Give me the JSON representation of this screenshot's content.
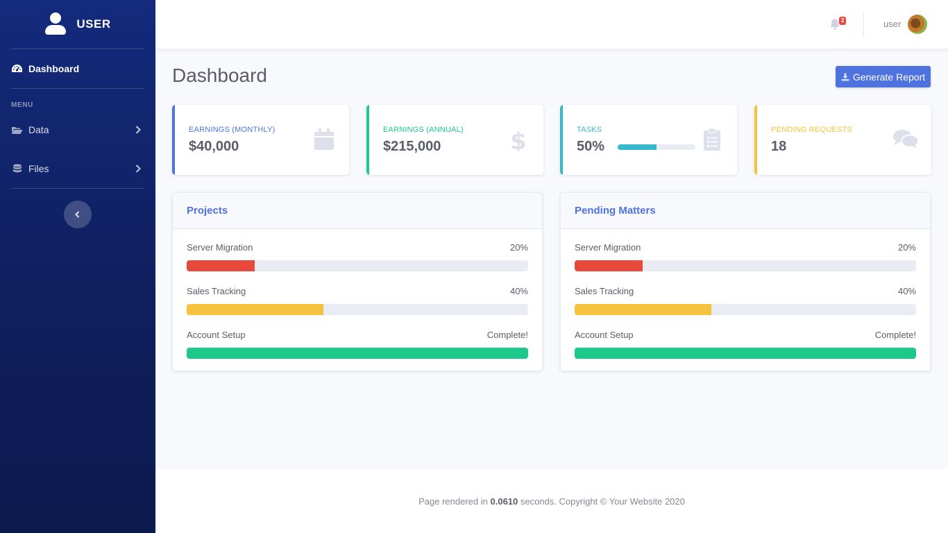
{
  "sidebar": {
    "brand": "USER",
    "active_item": {
      "label": "Dashboard",
      "icon": "tachometer-icon"
    },
    "menu_heading": "MENU",
    "items": [
      {
        "label": "Data",
        "icon": "folder-open-icon"
      },
      {
        "label": "Files",
        "icon": "database-icon"
      }
    ],
    "toggle_icon": "chevron-left-icon"
  },
  "topbar": {
    "notification_count": "2",
    "user_name": "user"
  },
  "page": {
    "title": "Dashboard",
    "report_button": "Generate Report"
  },
  "cards": [
    {
      "label": "EARNINGS (MONTHLY)",
      "value": "$40,000",
      "color": "#4e73df",
      "icon": "calendar-icon"
    },
    {
      "label": "EARNINGS (ANNUAL)",
      "value": "$215,000",
      "color": "#1cc88a",
      "icon": "dollar-icon"
    },
    {
      "label": "TASKS",
      "value": "50%",
      "progress": 0.5,
      "color": "#36b9cc",
      "icon": "clipboard-list-icon"
    },
    {
      "label": "PENDING REQUESTS",
      "value": "18",
      "color": "#f6c23e",
      "icon": "comments-icon"
    }
  ],
  "panels": [
    {
      "title": "Projects",
      "rows": [
        {
          "label": "Server Migration",
          "value": "20%",
          "fraction": 0.2,
          "color": "#e74a3b"
        },
        {
          "label": "Sales Tracking",
          "value": "40%",
          "fraction": 0.4,
          "color": "#f6c23e"
        },
        {
          "label": "Account Setup",
          "value": "Complete!",
          "fraction": 1.0,
          "color": "#1cc88a"
        }
      ]
    },
    {
      "title": "Pending Matters",
      "rows": [
        {
          "label": "Server Migration",
          "value": "20%",
          "fraction": 0.2,
          "color": "#e74a3b"
        },
        {
          "label": "Sales Tracking",
          "value": "40%",
          "fraction": 0.4,
          "color": "#f6c23e"
        },
        {
          "label": "Account Setup",
          "value": "Complete!",
          "fraction": 1.0,
          "color": "#1cc88a"
        }
      ]
    }
  ],
  "footer": {
    "prefix": "Page rendered in",
    "time": "0.0610",
    "suffix": "seconds. Copyright © Your Website 2020"
  }
}
